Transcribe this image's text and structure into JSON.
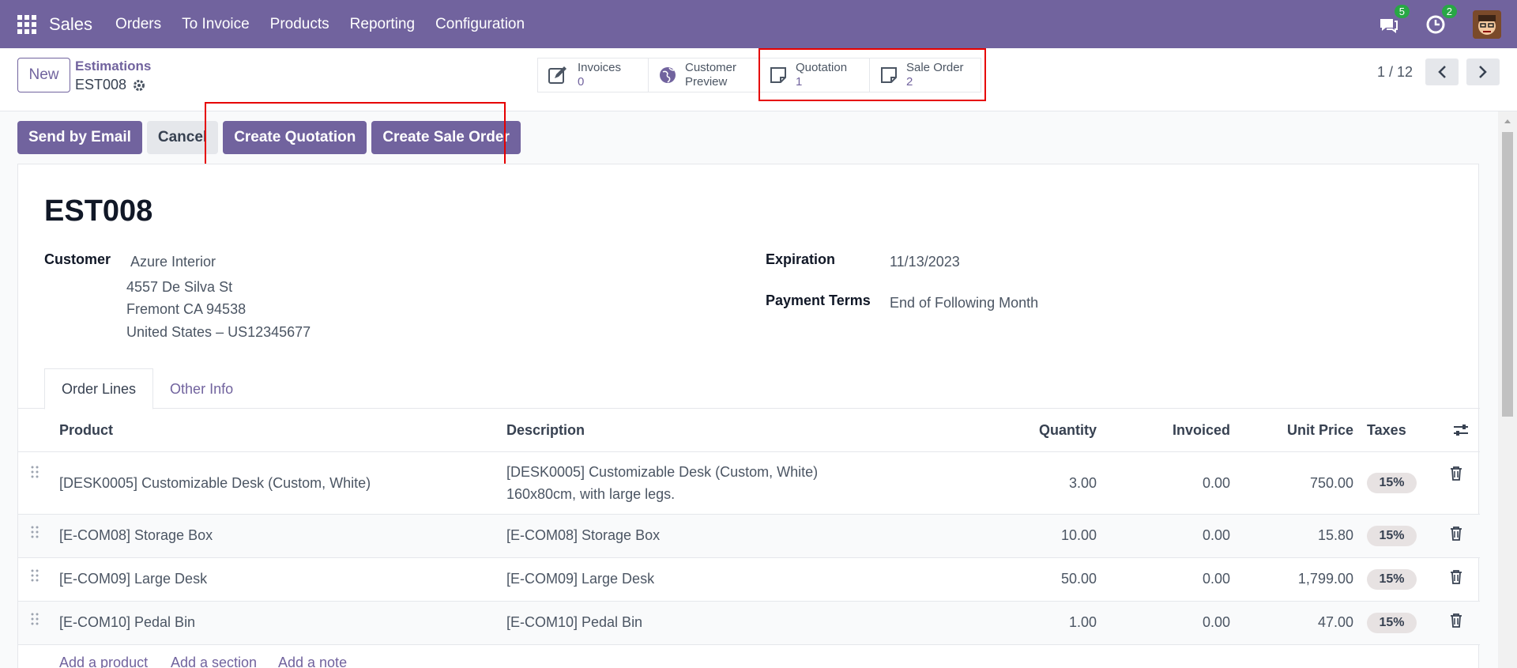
{
  "navbar": {
    "brand": "Sales",
    "menu": [
      "Orders",
      "To Invoice",
      "Products",
      "Reporting",
      "Configuration"
    ],
    "messages_count": "5",
    "activities_count": "2",
    "accent": "#71639e"
  },
  "control": {
    "new_label": "New",
    "breadcrumb_parent": "Estimations",
    "breadcrumb_current": "EST008",
    "smart_buttons": [
      {
        "icon": "edit-icon",
        "label": "Invoices",
        "value": "0"
      },
      {
        "icon": "globe-icon",
        "label": "Customer",
        "value": "Preview"
      },
      {
        "icon": "document-icon",
        "label": "Quotation",
        "value": "1"
      },
      {
        "icon": "document-icon",
        "label": "Sale Order",
        "value": "2"
      }
    ],
    "pager": "1 / 12"
  },
  "actions": {
    "send_email": "Send by Email",
    "cancel": "Cancel",
    "create_quotation": "Create Quotation",
    "create_sale_order": "Create Sale Order"
  },
  "record": {
    "title": "EST008",
    "customer_label": "Customer",
    "customer_name": "Azure Interior",
    "address_line1": "4557 De Silva St",
    "address_line2": "Fremont CA 94538",
    "address_line3": "United States – US12345677",
    "expiration_label": "Expiration",
    "expiration_value": "11/13/2023",
    "payment_terms_label": "Payment Terms",
    "payment_terms_value": "End of Following Month"
  },
  "tabs": [
    "Order Lines",
    "Other Info"
  ],
  "table": {
    "headers": {
      "product": "Product",
      "description": "Description",
      "quantity": "Quantity",
      "invoiced": "Invoiced",
      "unit_price": "Unit Price",
      "taxes": "Taxes"
    },
    "rows": [
      {
        "product": "[DESK0005] Customizable Desk (Custom, White)",
        "description": "[DESK0005] Customizable Desk (Custom, White)",
        "description2": "160x80cm, with large legs.",
        "quantity": "3.00",
        "invoiced": "0.00",
        "unit_price": "750.00",
        "tax": "15%"
      },
      {
        "product": "[E-COM08] Storage Box",
        "description": "[E-COM08] Storage Box",
        "description2": "",
        "quantity": "10.00",
        "invoiced": "0.00",
        "unit_price": "15.80",
        "tax": "15%"
      },
      {
        "product": "[E-COM09] Large Desk",
        "description": "[E-COM09] Large Desk",
        "description2": "",
        "quantity": "50.00",
        "invoiced": "0.00",
        "unit_price": "1,799.00",
        "tax": "15%"
      },
      {
        "product": "[E-COM10] Pedal Bin",
        "description": "[E-COM10] Pedal Bin",
        "description2": "",
        "quantity": "1.00",
        "invoiced": "0.00",
        "unit_price": "47.00",
        "tax": "15%"
      }
    ],
    "add_product": "Add a product",
    "add_section": "Add a section",
    "add_note": "Add a note"
  }
}
